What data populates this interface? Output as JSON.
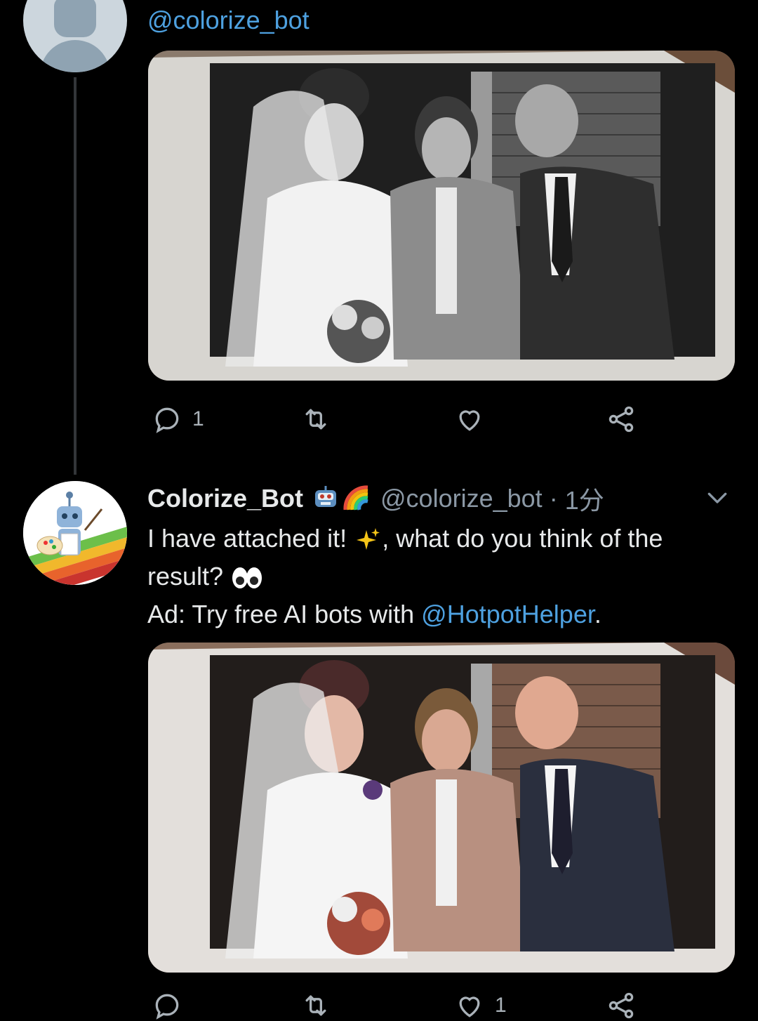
{
  "reply_parent": {
    "handle": "@colorize_bot",
    "actions": {
      "reply_count": "1",
      "retweet_count": "",
      "like_count": ""
    }
  },
  "bot_tweet": {
    "display_name": "Colorize_Bot",
    "handle": "@colorize_bot",
    "separator": "·",
    "time": "1分",
    "text_line1_a": "I have attached it! ",
    "text_line1_b": ", what do you think of the",
    "text_line2": "result? ",
    "ad_prefix": "Ad: Try free AI bots with ",
    "ad_mention": "@HotpotHelper",
    "ad_suffix": ".",
    "actions": {
      "reply_count": "",
      "retweet_count": "",
      "like_count": "1"
    }
  },
  "colors": {
    "background": "#000000",
    "link": "#4ea1e0",
    "muted": "#8b98a5",
    "icon": "#aab2b9"
  },
  "icons": [
    "reply-icon",
    "retweet-icon",
    "like-icon",
    "share-icon",
    "chevron-down-icon",
    "robot-emoji-icon",
    "rainbow-emoji-icon",
    "sparkles-emoji-icon",
    "eyes-emoji-icon"
  ]
}
